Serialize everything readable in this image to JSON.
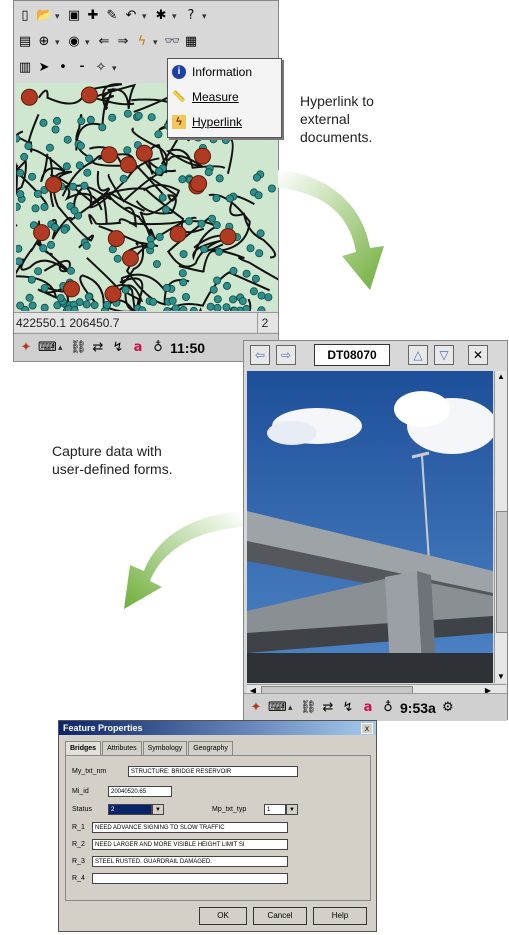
{
  "map_window": {
    "popup_menu": [
      {
        "label": "Information",
        "icon": "info-icon"
      },
      {
        "label": "Measure",
        "icon": "ruler-icon"
      },
      {
        "label": "Hyperlink",
        "icon": "lightning-icon"
      }
    ],
    "coordinates": "422550.1 206450.7",
    "status_right": "2",
    "clock": "11:50"
  },
  "photo_window": {
    "photo_id": "DT08070",
    "clock": "9:53a"
  },
  "captions": {
    "hyperlink": [
      "Hyperlink to",
      "external",
      "documents."
    ],
    "capture": [
      "Capture data with",
      "user-defined forms."
    ]
  },
  "dialog": {
    "title": "Feature Properties",
    "close": "x",
    "tabs": [
      "Bridges",
      "Attributes",
      "Symbology",
      "Geography"
    ],
    "fields": [
      {
        "label": "My_txt_nm",
        "value": "STRUCTURE: BRIDGE RESERVOIR"
      },
      {
        "label": "Mi_id",
        "value": "20040520.65"
      },
      {
        "label": "Status",
        "value": "2"
      },
      {
        "label": "R_1",
        "value": "NEED ADVANCE SIGNING TO SLOW TRAFFIC"
      },
      {
        "label": "R_2",
        "value": "NEED LARGER AND MORE VISIBLE HEIGHT LIMIT SI"
      },
      {
        "label": "R_3",
        "value": "STEEL RUSTED. GUARDRAIL DAMAGED."
      },
      {
        "label": "R_4",
        "value": ""
      }
    ],
    "type_label": "Mp_txt_typ",
    "type_value": "1",
    "buttons": {
      "ok": "OK",
      "cancel": "Cancel",
      "help": "Help"
    }
  },
  "colors": {
    "map_bg": "#cfe6cf",
    "node_large": "#b03a22",
    "node_small": "#2f8f8a",
    "arrow_green": "#7cb342",
    "accent_blue": "#0a246a"
  }
}
